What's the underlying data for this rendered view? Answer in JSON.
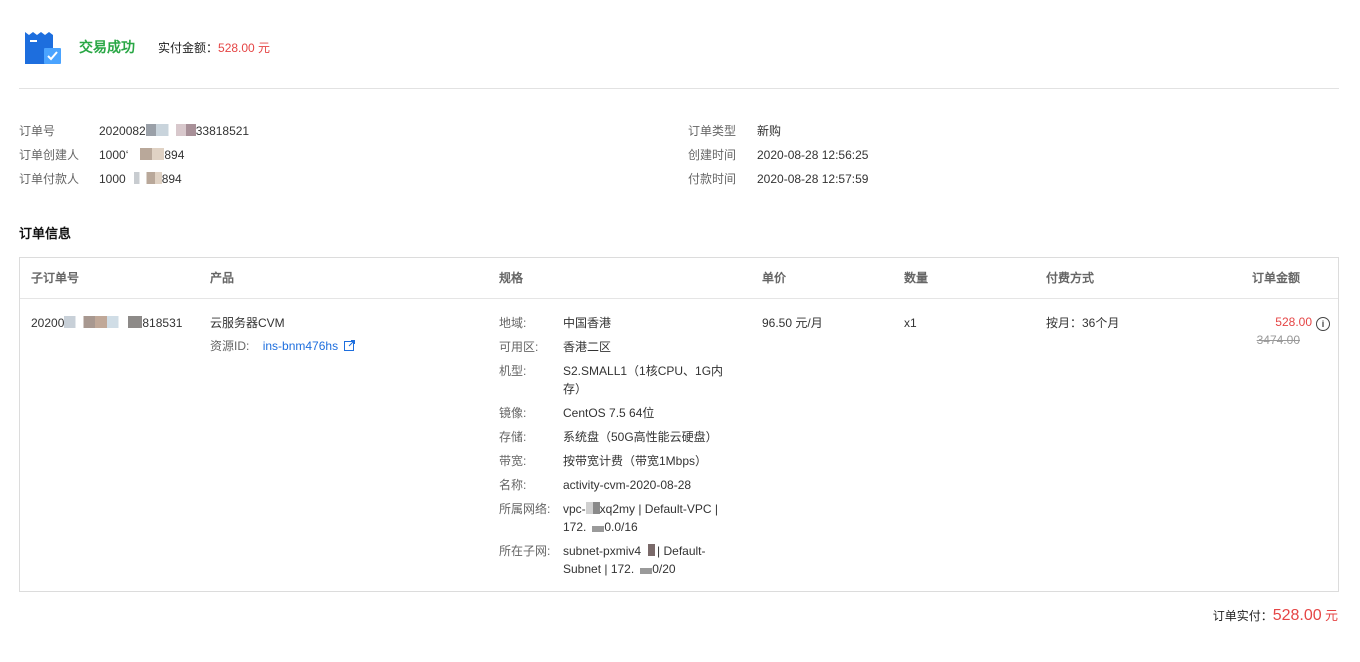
{
  "header": {
    "status": "交易成功",
    "paid_label": "实付金额：",
    "paid_value": "528.00 元",
    "icon": "receipt-check-icon"
  },
  "meta": {
    "order_no_label": "订单号",
    "order_no_a": "2020082",
    "order_no_b": "33818521",
    "creator_label": "订单创建人",
    "creator_a": "1000‘",
    "creator_b": "894",
    "payer_label": "订单付款人",
    "payer_a": "1000",
    "payer_b": "894",
    "type_label": "订单类型",
    "type_value": "新购",
    "created_label": "创建时间",
    "created_value": "2020-08-28 12:56:25",
    "paid_time_label": "付款时间",
    "paid_time_value": "2020-08-28 12:57:59"
  },
  "section_title": "订单信息",
  "table": {
    "headers": {
      "sub_order": "子订单号",
      "product": "产品",
      "spec": "规格",
      "unit_price": "单价",
      "quantity": "数量",
      "billing": "付费方式",
      "amount": "订单金额"
    },
    "row": {
      "sub_order_a": "20200",
      "sub_order_b": "818531",
      "product": "云服务器CVM",
      "resource_label": "资源ID:",
      "resource_id": "ins-bnm476hs",
      "unit_price": "96.50 元/月",
      "quantity": "x1",
      "billing": "按月：36个月",
      "amount": "528.00",
      "amount_original": "3474.00",
      "specs": [
        {
          "label": "地域:",
          "value": "中国香港"
        },
        {
          "label": "可用区:",
          "value": "香港二区"
        },
        {
          "label": "机型:",
          "value": "S2.SMALL1（1核CPU、1G内存）"
        },
        {
          "label": "镜像:",
          "value": "CentOS 7.5 64位"
        },
        {
          "label": "存储:",
          "value": "系统盘（50G高性能云硬盘）"
        },
        {
          "label": "带宽:",
          "value": "按带宽计费（带宽1Mbps）"
        },
        {
          "label": "名称:",
          "value": "activity-cvm-2020-08-28"
        },
        {
          "label": "所属网络:",
          "value_a": "vpc-",
          "value_b": "xq2my | Default-VPC | 172.",
          "value_c": "0.0/16"
        },
        {
          "label": "所在子网:",
          "value_a": "subnet-pxmiv4",
          "value_b": "| Default-Subnet | 172.",
          "value_c": "0/20"
        }
      ]
    }
  },
  "footer": {
    "total_label": "订单实付：",
    "total_value": "528.00",
    "total_unit": "元"
  },
  "colors": {
    "success": "#29a745",
    "price": "#e54545",
    "link": "#1d6ede"
  }
}
